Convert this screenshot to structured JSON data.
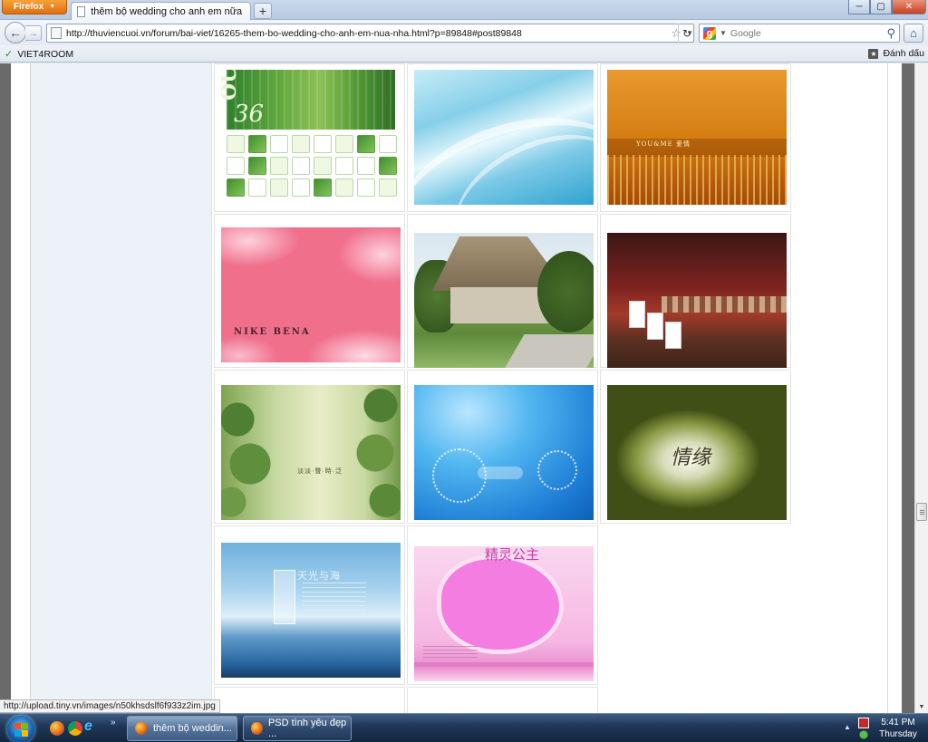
{
  "browser": {
    "menu_button_label": "Firefox",
    "tab_title": "thêm bộ wedding cho anh em nữa nha",
    "new_tab_label": "+",
    "window_controls": {
      "minimize": "─",
      "maximize": "▢",
      "close": "✕"
    },
    "url": "http://thuviencuoi.vn/forum/bai-viet/16265-them-bo-wedding-cho-anh-em-nua-nha.html?p=89848#post89848",
    "search_placeholder": "Google",
    "bookmark_label": "VIET4ROOM",
    "bookmark_right_label": "Đánh dấu"
  },
  "status_bar": {
    "text": "http://upload.tiny.vn/images/n50khsdslf6f933z2im.jpg"
  },
  "gallery": {
    "thumb_texts": {
      "our": "OUR",
      "number": "36",
      "you_me": "YOU&ME 爱情",
      "pink_text": "NIKE BENA",
      "nature": "淡淡·聲·時·泛",
      "ocean": "天光与海",
      "pink_title": "精灵公主",
      "signature": "情缘"
    }
  },
  "taskbar": {
    "quicklaunch_more": "»",
    "tasks": [
      {
        "label": "thêm bộ weddin...",
        "active": true
      },
      {
        "label": "PSD tình yêu đẹp ...",
        "active": false
      }
    ],
    "clock_time": "5:41 PM",
    "clock_day": "Thursday"
  }
}
